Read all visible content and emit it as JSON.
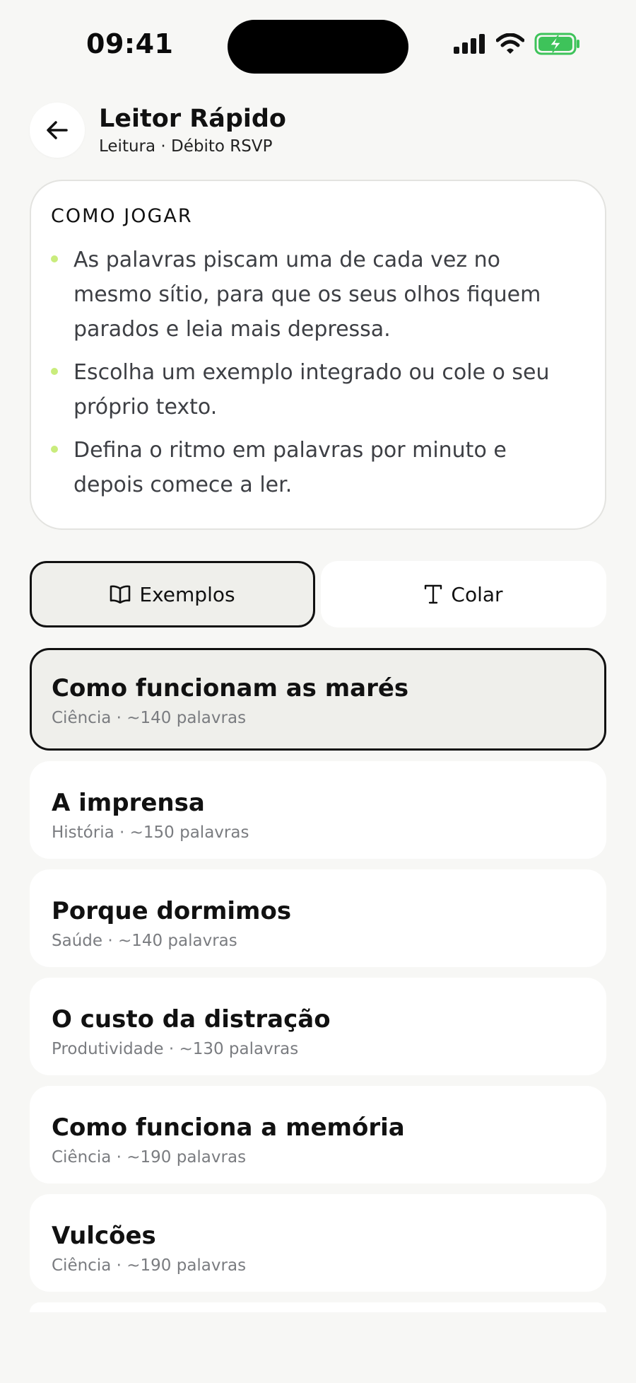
{
  "status": {
    "time": "09:41",
    "battery_color": "#3ec35a"
  },
  "header": {
    "back_icon": "arrow-left-icon",
    "title": "Leitor Rápido",
    "subtitle": "Leitura · Débito RSVP"
  },
  "help": {
    "heading": "COMO JOGAR",
    "bullet_color": "#c9ec7c",
    "items": [
      "As palavras piscam uma de cada vez no mesmo sítio, para que os seus olhos fiquem parados e leia mais depressa.",
      "Escolha um exemplo integrado ou cole o seu próprio texto.",
      "Defina o ritmo em palavras por minuto e depois comece a ler."
    ]
  },
  "tabs": [
    {
      "label": "Exemplos",
      "icon": "book-open-icon",
      "active": true
    },
    {
      "label": "Colar",
      "icon": "text-type-icon",
      "active": false
    }
  ],
  "examples": [
    {
      "title": "Como funcionam as marés",
      "meta": "Ciência · ~140 palavras",
      "selected": true
    },
    {
      "title": "A imprensa",
      "meta": "História · ~150 palavras",
      "selected": false
    },
    {
      "title": "Porque dormimos",
      "meta": "Saúde · ~140 palavras",
      "selected": false
    },
    {
      "title": "O custo da distração",
      "meta": "Produtividade · ~130 palavras",
      "selected": false
    },
    {
      "title": "Como funciona a memória",
      "meta": "Ciência · ~190 palavras",
      "selected": false
    },
    {
      "title": "Vulcões",
      "meta": "Ciência · ~190 palavras",
      "selected": false
    }
  ]
}
